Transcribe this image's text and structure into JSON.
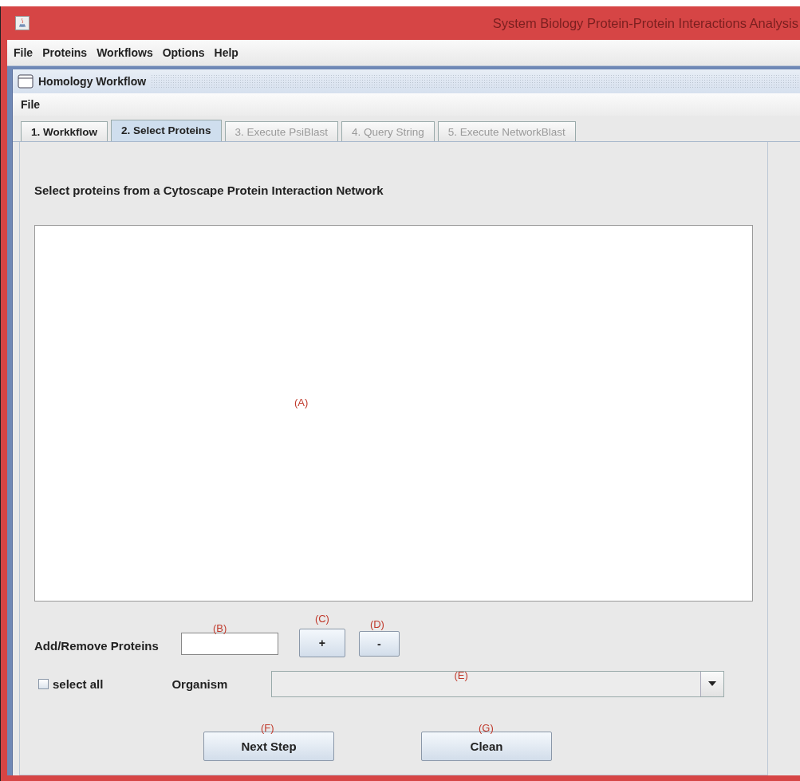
{
  "window": {
    "title": "System Biology Protein-Protein Interactions Analysis"
  },
  "menu_bar": [
    "File",
    "Proteins",
    "Workflows",
    "Options",
    "Help"
  ],
  "internal_frame": {
    "title": "Homology Workflow",
    "menu_bar": [
      "File"
    ]
  },
  "tabs": [
    {
      "label": "1. Workkflow",
      "selected": false,
      "disabled": false
    },
    {
      "label": "2. Select Proteins",
      "selected": true,
      "disabled": false
    },
    {
      "label": "3. Execute PsiBlast",
      "selected": false,
      "disabled": true
    },
    {
      "label": "4. Query String",
      "selected": false,
      "disabled": true
    },
    {
      "label": "5. Execute NetworkBlast",
      "selected": false,
      "disabled": true
    }
  ],
  "heading": "Select proteins from a Cytoscape Protein Interaction Network",
  "protein_list": {
    "annotation": "(A)"
  },
  "add_remove": {
    "label": "Add/Remove Proteins",
    "field_annotation": "(B)",
    "add_button": "+",
    "add_annotation": "(C)",
    "remove_button": "-",
    "remove_annotation": "(D)"
  },
  "select_all": {
    "label": "select all",
    "checked": false
  },
  "organism": {
    "label": "Organism",
    "annotation": "(E)"
  },
  "buttons": [
    {
      "label": "Next Step",
      "annotation": "(F)"
    },
    {
      "label": "Clean",
      "annotation": "(G)"
    }
  ]
}
